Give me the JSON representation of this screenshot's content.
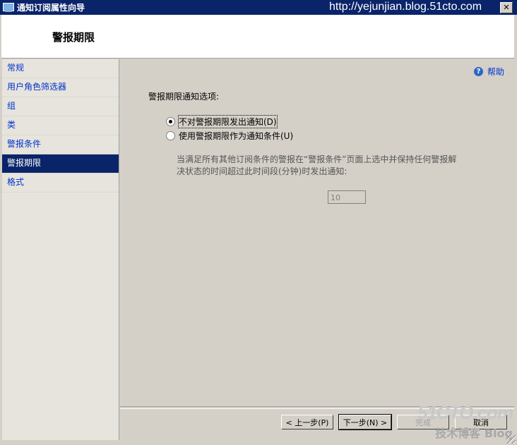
{
  "window": {
    "title": "通知订阅属性向导",
    "watermark_url": "http://yejunjian.blog.51cto.com",
    "close_glyph": "✕"
  },
  "header": {
    "page_title": "警报期限"
  },
  "sidebar": {
    "items": [
      {
        "label": "常规",
        "selected": false
      },
      {
        "label": "用户角色筛选器",
        "selected": false
      },
      {
        "label": "组",
        "selected": false
      },
      {
        "label": "类",
        "selected": false
      },
      {
        "label": "警报条件",
        "selected": false
      },
      {
        "label": "警报期限",
        "selected": true
      },
      {
        "label": "格式",
        "selected": false
      }
    ]
  },
  "main": {
    "help_label": "帮助",
    "section_label": "警报期限通知选项:",
    "options": [
      {
        "label": "不对警报期限发出通知(D)",
        "checked": true
      },
      {
        "label": "使用警报期限作为通知条件(U)",
        "checked": false
      }
    ],
    "description": "当满足所有其他订阅条件的警报在“警报条件”页面上选中并保持任何警报解决状态的时间超过此时间段(分钟)时发出通知:",
    "minutes_value": "10"
  },
  "buttons": {
    "back": "< 上一步(P)",
    "next": "下一步(N) >",
    "finish": "完成",
    "cancel": "取消"
  },
  "watermark": {
    "logo": "51CTO.com",
    "sub": "技术博客 Blog"
  },
  "colors": {
    "titlebar": "#0a246a",
    "selected_nav": "#0a246a",
    "link": "#0033cc",
    "panel": "#d4d0c8"
  }
}
